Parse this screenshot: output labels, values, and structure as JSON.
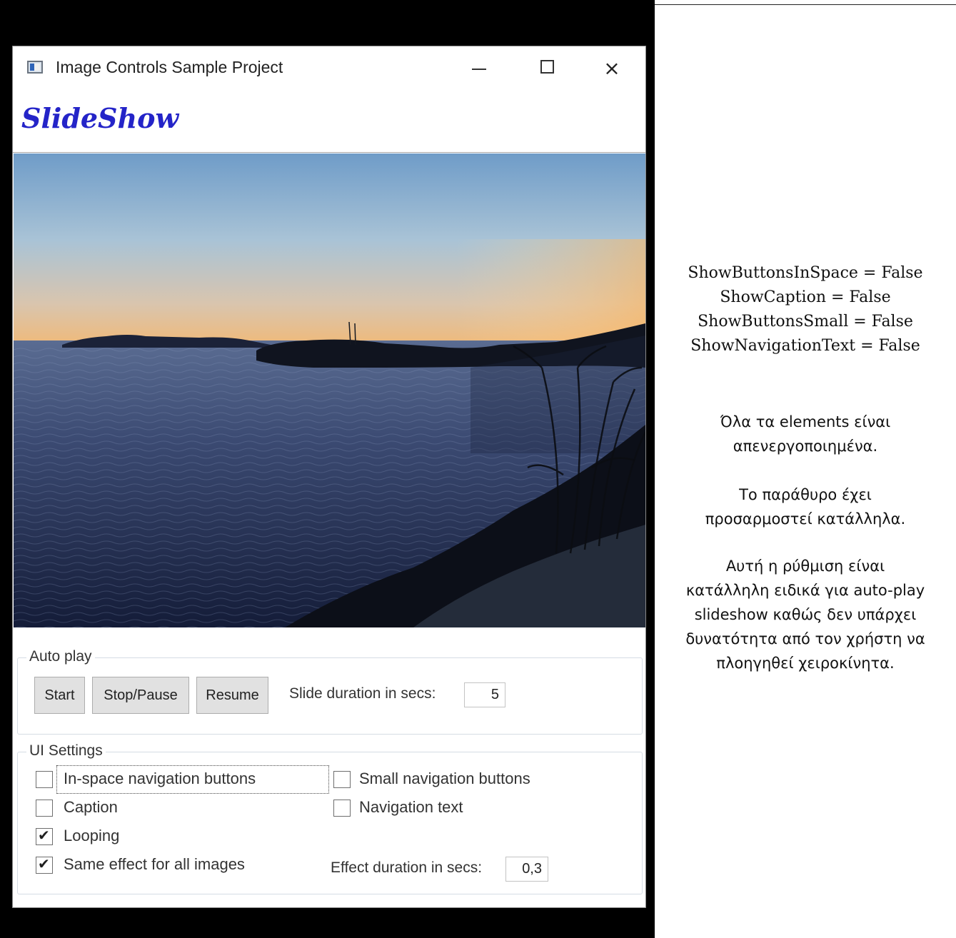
{
  "window": {
    "title": "Image Controls Sample Project",
    "controls": {
      "minimize": "minimize",
      "maximize": "maximize",
      "close": "×"
    }
  },
  "header": {
    "title": "SlideShow"
  },
  "slide": {
    "description": "sunset over sea"
  },
  "auto_play": {
    "legend": "Auto play",
    "start_label": "Start",
    "stop_label": "Stop/Pause",
    "resume_label": "Resume",
    "duration_label": "Slide duration in secs:",
    "duration_value": "5"
  },
  "ui_settings": {
    "legend": "UI Settings",
    "in_space": {
      "label": "In-space navigation buttons",
      "checked": false
    },
    "small_nav": {
      "label": "Small navigation buttons",
      "checked": false
    },
    "caption": {
      "label": "Caption",
      "checked": false
    },
    "nav_text": {
      "label": "Navigation text",
      "checked": false
    },
    "looping": {
      "label": "Looping",
      "checked": true
    },
    "same_effect": {
      "label": "Same effect for all images",
      "checked": true
    },
    "effect_duration_label": "Effect duration in secs:",
    "effect_duration_value": "0,3"
  },
  "notes": {
    "settings": [
      "ShowButtonsInSpace = False",
      "ShowCaption = False",
      "ShowButtonsSmall = False",
      "ShowNavigationText = False"
    ],
    "para1": [
      "Όλα τα elements είναι",
      "απενεργοποιημένα."
    ],
    "para2": [
      "Το παράθυρο έχει",
      "προσαρμοστεί κατάλληλα."
    ],
    "para3": [
      "Αυτή η ρύθμιση είναι",
      "κατάλληλη ειδικά για auto-play",
      "slideshow καθώς δεν υπάρχει",
      "δυνατότητα από τον χρήστη να",
      "πλοηγηθεί χειροκίνητα."
    ]
  },
  "colors": {
    "title_blue": "#2424c8",
    "black_panel": "#000000",
    "button_bg": "#e1e1e1"
  }
}
